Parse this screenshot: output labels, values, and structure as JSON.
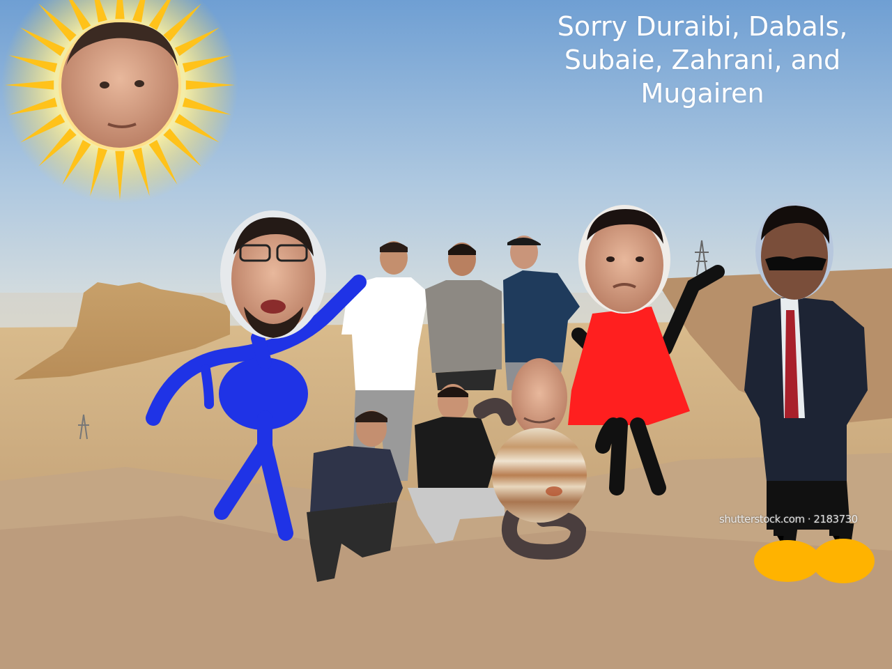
{
  "caption": {
    "text": "Sorry Duraibi, Dabals,\nSubaie, Zahrani, and\nMugairen",
    "color": "#ffffff"
  },
  "watermark": {
    "text": "shutterstock.com · 2183730"
  },
  "colors": {
    "sky_top": "#6f9fd3",
    "sky_horizon": "#d9dfe1",
    "desert": "#d7b98a",
    "ground": "#c9ab84",
    "blue_figure": "#1f33e6",
    "red_figure": "#ff1f1f",
    "black_figure": "#111111",
    "sun_rays": "#ffc21a",
    "shoes": "#ffb300",
    "planet_loop": "#4a3e3e"
  },
  "icons": {
    "sun": "sun-icon",
    "planet": "jupiter-icon"
  }
}
